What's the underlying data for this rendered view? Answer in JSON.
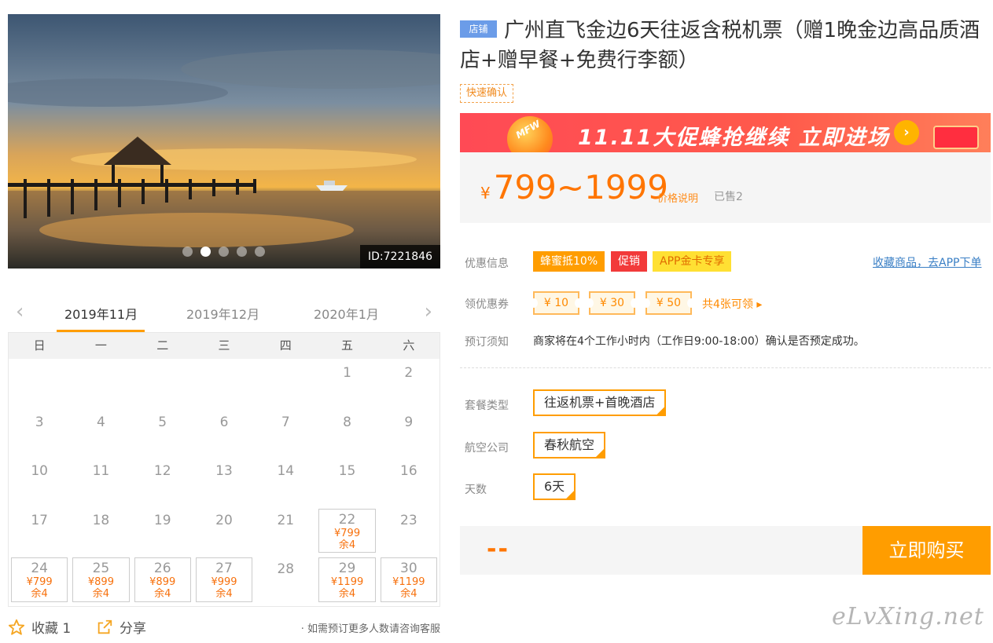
{
  "gallery": {
    "image_id": "ID:7221846",
    "dots": [
      false,
      true,
      false,
      false,
      false
    ]
  },
  "calendar": {
    "prev_arrow": "‹",
    "next_arrow": "›",
    "tabs": [
      "2019年11月",
      "2019年12月",
      "2020年1月"
    ],
    "weekdays": [
      "日",
      "一",
      "二",
      "三",
      "四",
      "五",
      "六"
    ],
    "days": [
      {
        "day": ""
      },
      {
        "day": ""
      },
      {
        "day": ""
      },
      {
        "day": ""
      },
      {
        "day": ""
      },
      {
        "day": "1"
      },
      {
        "day": "2"
      },
      {
        "day": "3"
      },
      {
        "day": "4"
      },
      {
        "day": "5"
      },
      {
        "day": "6"
      },
      {
        "day": "7"
      },
      {
        "day": "8"
      },
      {
        "day": "9"
      },
      {
        "day": "10"
      },
      {
        "day": "11"
      },
      {
        "day": "12"
      },
      {
        "day": "13"
      },
      {
        "day": "14"
      },
      {
        "day": "15"
      },
      {
        "day": "16"
      },
      {
        "day": "17"
      },
      {
        "day": "18"
      },
      {
        "day": "19"
      },
      {
        "day": "20"
      },
      {
        "day": "21"
      },
      {
        "day": "22",
        "price": "¥799",
        "stock": "余4"
      },
      {
        "day": "23"
      },
      {
        "day": "24",
        "price": "¥799",
        "stock": "余4"
      },
      {
        "day": "25",
        "price": "¥899",
        "stock": "余4"
      },
      {
        "day": "26",
        "price": "¥899",
        "stock": "余4"
      },
      {
        "day": "27",
        "price": "¥999",
        "stock": "余4"
      },
      {
        "day": "28"
      },
      {
        "day": "29",
        "price": "¥1199",
        "stock": "余4"
      },
      {
        "day": "30",
        "price": "¥1199",
        "stock": "余4"
      }
    ]
  },
  "actions": {
    "favorite_label": "收藏 1",
    "share_label": "分享",
    "note": "· 如需预订更多人数请咨询客服"
  },
  "product": {
    "shop_tag": "店铺",
    "title": "广州直飞金边6天往返含税机票（赠1晚金边高品质酒店+赠早餐+免费行李额）",
    "quick_confirm": "快速确认",
    "banner_text": "11.11大促蜂抢继续 立即进场",
    "banner_logo": "MFW",
    "banner_go": "›",
    "currency": "¥",
    "price_range": "799~1999",
    "price_note_link": "价格说明",
    "sold": "已售2"
  },
  "promos": {
    "label": "优惠信息",
    "badges": [
      "蜂蜜抵10%",
      "促销",
      "APP金卡专享"
    ],
    "link": "收藏商品，去APP下单"
  },
  "coupons": {
    "label": "领优惠券",
    "items": [
      "¥ 10",
      "¥ 30",
      "¥ 50"
    ],
    "more": "共4张可领 ▸"
  },
  "booking": {
    "label": "预订须知",
    "text": "商家将在4个工作小时内（工作日9:00-18:00）确认是否预定成功。"
  },
  "options": {
    "package_label": "套餐类型",
    "package_value": "往返机票+首晚酒店",
    "airline_label": "航空公司",
    "airline_value": "春秋航空",
    "days_label": "天数",
    "days_value": "6天"
  },
  "purchase": {
    "total": "--",
    "button": "立即购买"
  },
  "watermark": "eLvXing.net",
  "colors": {
    "accent": "#ff9d00",
    "price": "#ff7500",
    "promo_red": "#f23a3a",
    "link_blue": "#3a7fc5"
  }
}
